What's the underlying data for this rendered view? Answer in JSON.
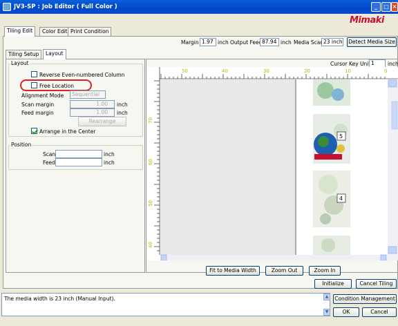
{
  "window": {
    "title": "JV3-SP : Job Editor ( Full Color )",
    "brand": "Mimaki",
    "buttons": {
      "minimize": "_",
      "maximize": "□",
      "close": "×"
    }
  },
  "tabs": {
    "main": [
      "Tiling Edit",
      "Color Edit",
      "Print Condition"
    ],
    "active_main": "Tiling Edit",
    "sub": [
      "Tiling Setup",
      "Layout"
    ],
    "active_sub": "Layout"
  },
  "topbar": {
    "margin_label": "Margin",
    "margin_value": "1.97",
    "margin_unit": "inch",
    "output_feed_label": "Output Feed",
    "output_feed_value": "87.94",
    "output_feed_unit": "inch",
    "media_scan_label": "Media Scan",
    "media_scan_value": "23 inch",
    "detect_button": "Detect Media Size"
  },
  "layout": {
    "group_label": "Layout",
    "reverse_even": "Reverse Even-numbered Column",
    "free_location": "Free Location",
    "alignment_mode_label": "Alignment Mode",
    "alignment_mode_value": "Sequential",
    "scan_margin_label": "Scan margin",
    "scan_margin_value": "1.00",
    "feed_margin_label": "Feed margin",
    "feed_margin_value": "1.00",
    "unit": "inch",
    "rearrange_button": "Rearrange",
    "arrange_center": "Arrange in the Center"
  },
  "position": {
    "group_label": "Position",
    "scan_label": "Scan",
    "feed_label": "Feed",
    "unit": "inch"
  },
  "canvas": {
    "cursor_key_unit_label": "Cursor Key Unit",
    "cursor_key_unit_value": "1",
    "cursor_key_unit_suffix": "inch",
    "ruler_top": [
      "50",
      "40",
      "30",
      "20",
      "10",
      "0"
    ],
    "ruler_left": [
      "70",
      "60",
      "50",
      "40"
    ],
    "tiles": [
      "5",
      "4"
    ]
  },
  "buttons": {
    "fit": "Fit to Media Width",
    "zoom_out": "Zoom Out",
    "zoom_in": "Zoom In",
    "initialize": "Initialize",
    "cancel_tiling": "Cancel Tiling",
    "condition_management": "Condition Management",
    "ok": "OK",
    "cancel": "Cancel"
  },
  "status": {
    "message": "The media width is 23 inch (Manual Input)."
  },
  "colors": {
    "title_bar": "#0a4ad0",
    "highlight": "#e02020",
    "brand": "#c8102e"
  }
}
